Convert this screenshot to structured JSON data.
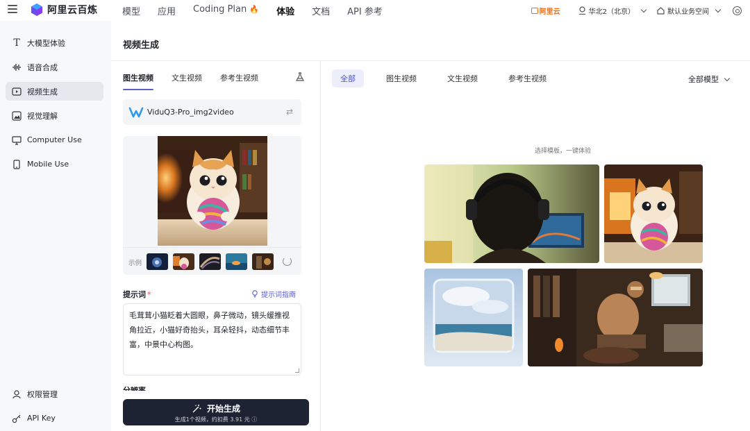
{
  "topbar": {
    "brand": "阿里云百炼",
    "nav": [
      "模型",
      "应用",
      "Coding Plan",
      "体验",
      "文档",
      "API 参考"
    ],
    "nav_active": "体验",
    "aliyun_label": "阿里云",
    "region": "华北2（北京）",
    "workspace": "默认业务空间"
  },
  "sidebar": {
    "items": [
      "大模型体验",
      "语音合成",
      "视频生成",
      "视觉理解",
      "Computer Use",
      "Mobile Use"
    ],
    "active": "视频生成",
    "bottom_items": [
      "权限管理",
      "API Key"
    ]
  },
  "main": {
    "title": "视频生成"
  },
  "left_panel": {
    "tabs": [
      "图生视频",
      "文生视频",
      "参考生视频"
    ],
    "active_tab": "图生视频",
    "model_name": "ViduQ3-Pro_img2video",
    "examples_label": "示例",
    "prompt_label": "提示词",
    "required_mark": "*",
    "prompt_guide": "提示词指南",
    "prompt_text": "毛茸茸小猫眨着大圆眼，鼻子微动，镜头缓推视角拉近，小猫好奇抬头，耳朵轻抖，动态细节丰富，中景中心构图。",
    "next_label": "分辨率",
    "generate_label": "开始生成",
    "generate_sub": "生成1个视频，约扣费 3.91 元"
  },
  "right_panel": {
    "tabs": [
      "全部",
      "图生视频",
      "文生视频",
      "参考生视频"
    ],
    "active_tab": "全部",
    "model_filter": "全部模型",
    "hint": "选择模板，一键体验"
  },
  "colors": {
    "accent": "#5b5fc7",
    "button_dark": "#1d2333",
    "aliyun_orange": "#ff6a00"
  }
}
